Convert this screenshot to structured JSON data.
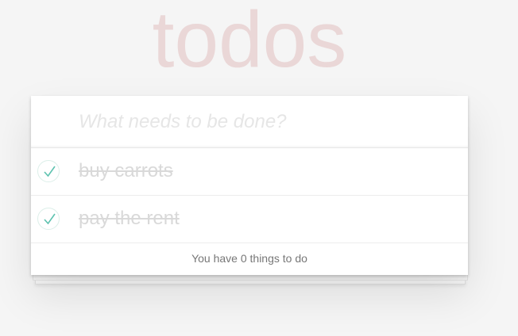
{
  "app": {
    "title": "todos"
  },
  "new_todo": {
    "placeholder": "What needs to be done?",
    "value": ""
  },
  "todos": [
    {
      "label": "buy carrots",
      "completed": true
    },
    {
      "label": "pay the rent",
      "completed": true
    }
  ],
  "footer": {
    "status_text": "You have 0 things to do"
  },
  "icons": {
    "toggle": "checkmark-icon"
  },
  "colors": {
    "title": "#ead7d7",
    "check": "#5dc2af",
    "background": "#f5f5f5"
  }
}
